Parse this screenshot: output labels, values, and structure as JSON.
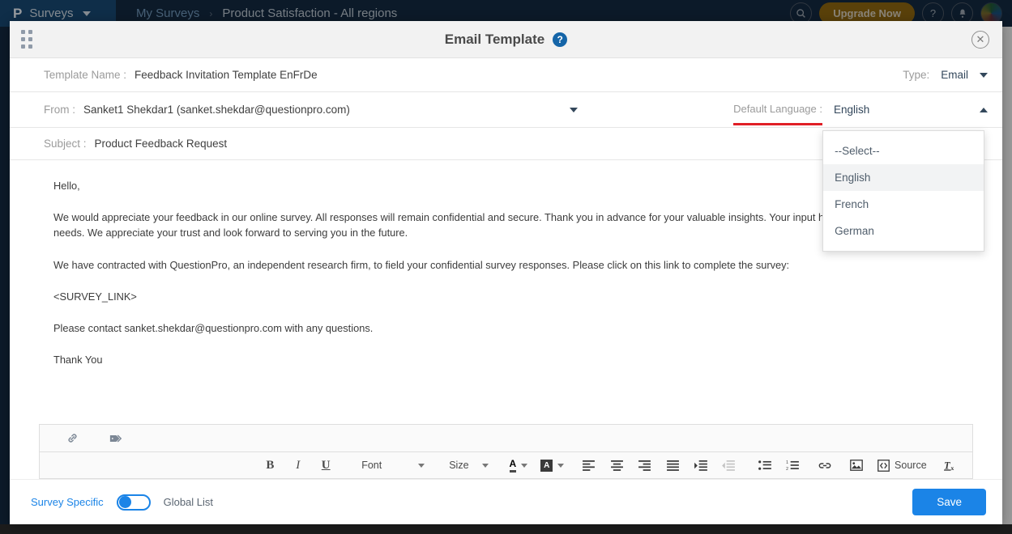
{
  "app": {
    "brand": "Surveys",
    "logo_glyph": "P",
    "breadcrumb_link": "My Surveys",
    "breadcrumb_separator": "›",
    "breadcrumb_current": "Product Satisfaction - All regions",
    "upgrade_label": "Upgrade Now",
    "search_glyph": "⌕",
    "help_glyph": "?",
    "bell_glyph": "▲"
  },
  "modal": {
    "title": "Email Template",
    "help_badge": "?",
    "close_glyph": "✕",
    "template_name": {
      "label": "Template Name :",
      "value": "Feedback Invitation Template EnFrDe"
    },
    "type": {
      "label": "Type:",
      "value": "Email"
    },
    "from": {
      "label": "From :",
      "value": "Sanket1 Shekdar1 (sanket.shekdar@questionpro.com)"
    },
    "default_language": {
      "label": "Default Language :",
      "value": "English",
      "underline_color": "#e01f26",
      "options": [
        "--Select--",
        "English",
        "French",
        "German"
      ],
      "selected_index": 1
    },
    "subject": {
      "label": "Subject :",
      "value": "Product Feedback Request"
    },
    "body": {
      "paragraphs": [
        "Hello,",
        "We would appreciate your feedback in our online survey. All responses will remain confidential and secure. Thank you in advance for your valuable insights. Your input helps us continue to meet your needs. We appreciate your trust and look forward to serving you in the future.",
        "We have contracted with QuestionPro, an independent research firm, to field your confidential survey responses. Please click on this link to complete the survey:",
        "<SURVEY_LINK>",
        "Please contact sanket.shekdar@questionpro.com with any questions.",
        "Thank You"
      ]
    },
    "toolbar": {
      "bold": "B",
      "italic": "I",
      "underline": "U",
      "font_label": "Font",
      "size_label": "Size",
      "text_color_glyph": "A",
      "bg_color_glyph": "A",
      "source_label": "Source",
      "remove_format_glyph": "Tx"
    },
    "footer": {
      "survey_specific": "Survey Specific",
      "global_list": "Global List",
      "save": "Save",
      "accent": "#1b84e7"
    }
  }
}
